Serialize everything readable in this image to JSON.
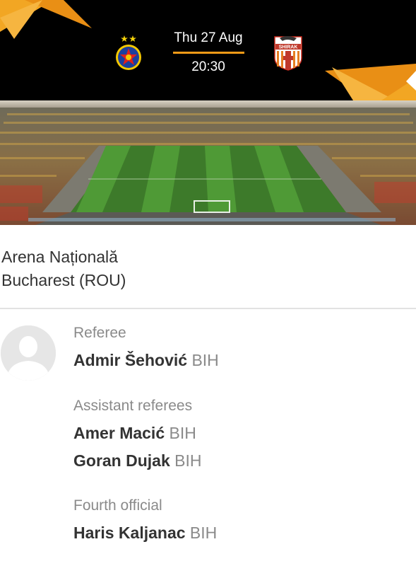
{
  "match": {
    "date": "Thu 27 Aug",
    "time": "20:30",
    "home_crest_icon": "fcsb-crest-icon",
    "away_crest_icon": "shirak-crest-icon",
    "away_crest_text": "SHIRAK",
    "accent_color": "#f39b17"
  },
  "venue": {
    "name": "Arena Națională",
    "city": "Bucharest (ROU)"
  },
  "officials": {
    "referee_label": "Referee",
    "referee": {
      "name": "Admir Šehović",
      "country": "BIH"
    },
    "assistants_label": "Assistant referees",
    "assistants": [
      {
        "name": "Amer Macić",
        "country": "BIH"
      },
      {
        "name": "Goran Dujak",
        "country": "BIH"
      }
    ],
    "fourth_label": "Fourth official",
    "fourth": {
      "name": "Haris Kaljanac",
      "country": "BIH"
    }
  }
}
